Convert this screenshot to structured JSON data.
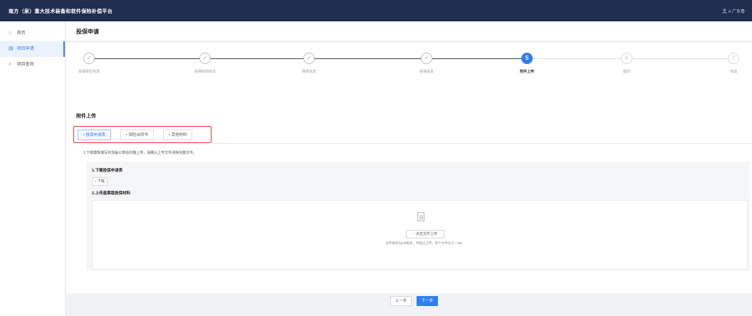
{
  "app": {
    "title": "南方（泉）重大技术装备和软件保险补偿平台"
  },
  "user": {
    "name": "A 广东粤",
    "icon": "user-icon"
  },
  "sidebar": {
    "items": [
      {
        "label": "首页",
        "icon": "home-icon"
      },
      {
        "label": "项目申请",
        "icon": "file-icon"
      },
      {
        "label": "项目查询",
        "icon": "search-icon"
      }
    ]
  },
  "page": {
    "title": "投保申请"
  },
  "steps": [
    {
      "label": "投保单位信息",
      "status": "done"
    },
    {
      "label": "投保标的信息",
      "status": "done"
    },
    {
      "label": "保单信息",
      "status": "done"
    },
    {
      "label": "投保信息",
      "status": "done"
    },
    {
      "label": "附件上传",
      "status": "active",
      "number": "5"
    },
    {
      "label": "提交",
      "status": "pending",
      "number": "6"
    },
    {
      "label": "完成",
      "status": "pending",
      "number": "7"
    }
  ],
  "upload": {
    "section_title": "附件上传",
    "tabs": [
      {
        "label": "• 投保申请表"
      },
      {
        "label": "• 保险合同书"
      },
      {
        "label": "• 其他材料"
      }
    ],
    "tip": "1.下载模板填写并加盖公章后扫描上传，请确认上传文件清晰完整文件。",
    "step1_title": "1.下载投保申请表",
    "download_label": "↓ 下载",
    "step2_title": "2.上传盖章版投保材料",
    "upload_button": "↑ 点击文件上传",
    "upload_hint": "文件格式为pdf格式，不超过上传，单个文件大小：5M"
  },
  "footer": {
    "prev_label": "上一步",
    "next_label": "下一步"
  },
  "colors": {
    "topbar": "#1f2d4f",
    "accent": "#2f7ef5",
    "highlight_box": "#e3342f"
  }
}
